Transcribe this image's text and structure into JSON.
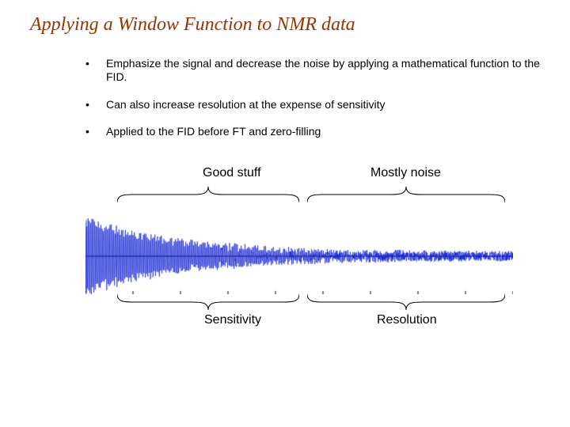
{
  "title": "Applying a Window Function to NMR data",
  "bullets": {
    "b1": "Emphasize the signal and decrease the noise by applying a mathematical function to the FID.",
    "b2": "Can also increase resolution at the expense of sensitivity",
    "b3": "Applied to the FID before FT and zero-filling"
  },
  "labels": {
    "good_stuff": "Good stuff",
    "mostly_noise": "Mostly noise",
    "sensitivity": "Sensitivity",
    "resolution": "Resolution"
  },
  "fid": {
    "color": "#1020d0",
    "axis_color": "#000000",
    "points": 2200,
    "initial_amplitude": 46,
    "noise_floor": 6,
    "decay_tau": 520,
    "carrier_freq": 0.95
  }
}
